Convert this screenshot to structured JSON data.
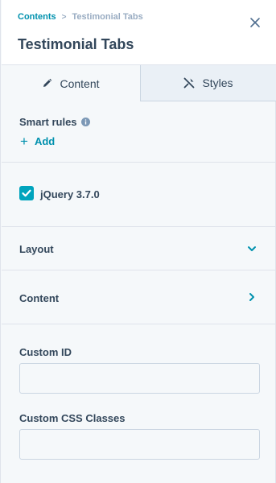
{
  "header": {
    "breadcrumb": {
      "parent": "Contents",
      "separator": ">",
      "current": "Testimonial Tabs"
    },
    "title": "Testimonial Tabs",
    "close_icon": "close-icon"
  },
  "tabs": [
    {
      "label": "Content",
      "icon": "pencil-icon",
      "active": true
    },
    {
      "label": "Styles",
      "icon": "brush-icon",
      "active": false
    }
  ],
  "smart_rules": {
    "label": "Smart rules",
    "info_icon": "info-icon",
    "add_label": "Add"
  },
  "jquery": {
    "label": "jQuery 3.7.0",
    "checked": true
  },
  "sections": [
    {
      "label": "Layout",
      "icon": "chevron-down-icon"
    },
    {
      "label": "Content",
      "icon": "chevron-right-icon"
    }
  ],
  "fields": {
    "custom_id": {
      "label": "Custom ID",
      "value": ""
    },
    "custom_css": {
      "label": "Custom CSS Classes",
      "value": ""
    }
  },
  "colors": {
    "accent": "#0091ae",
    "checkbox": "#00a4bd",
    "text": "#33475b",
    "muted": "#99acc2"
  }
}
